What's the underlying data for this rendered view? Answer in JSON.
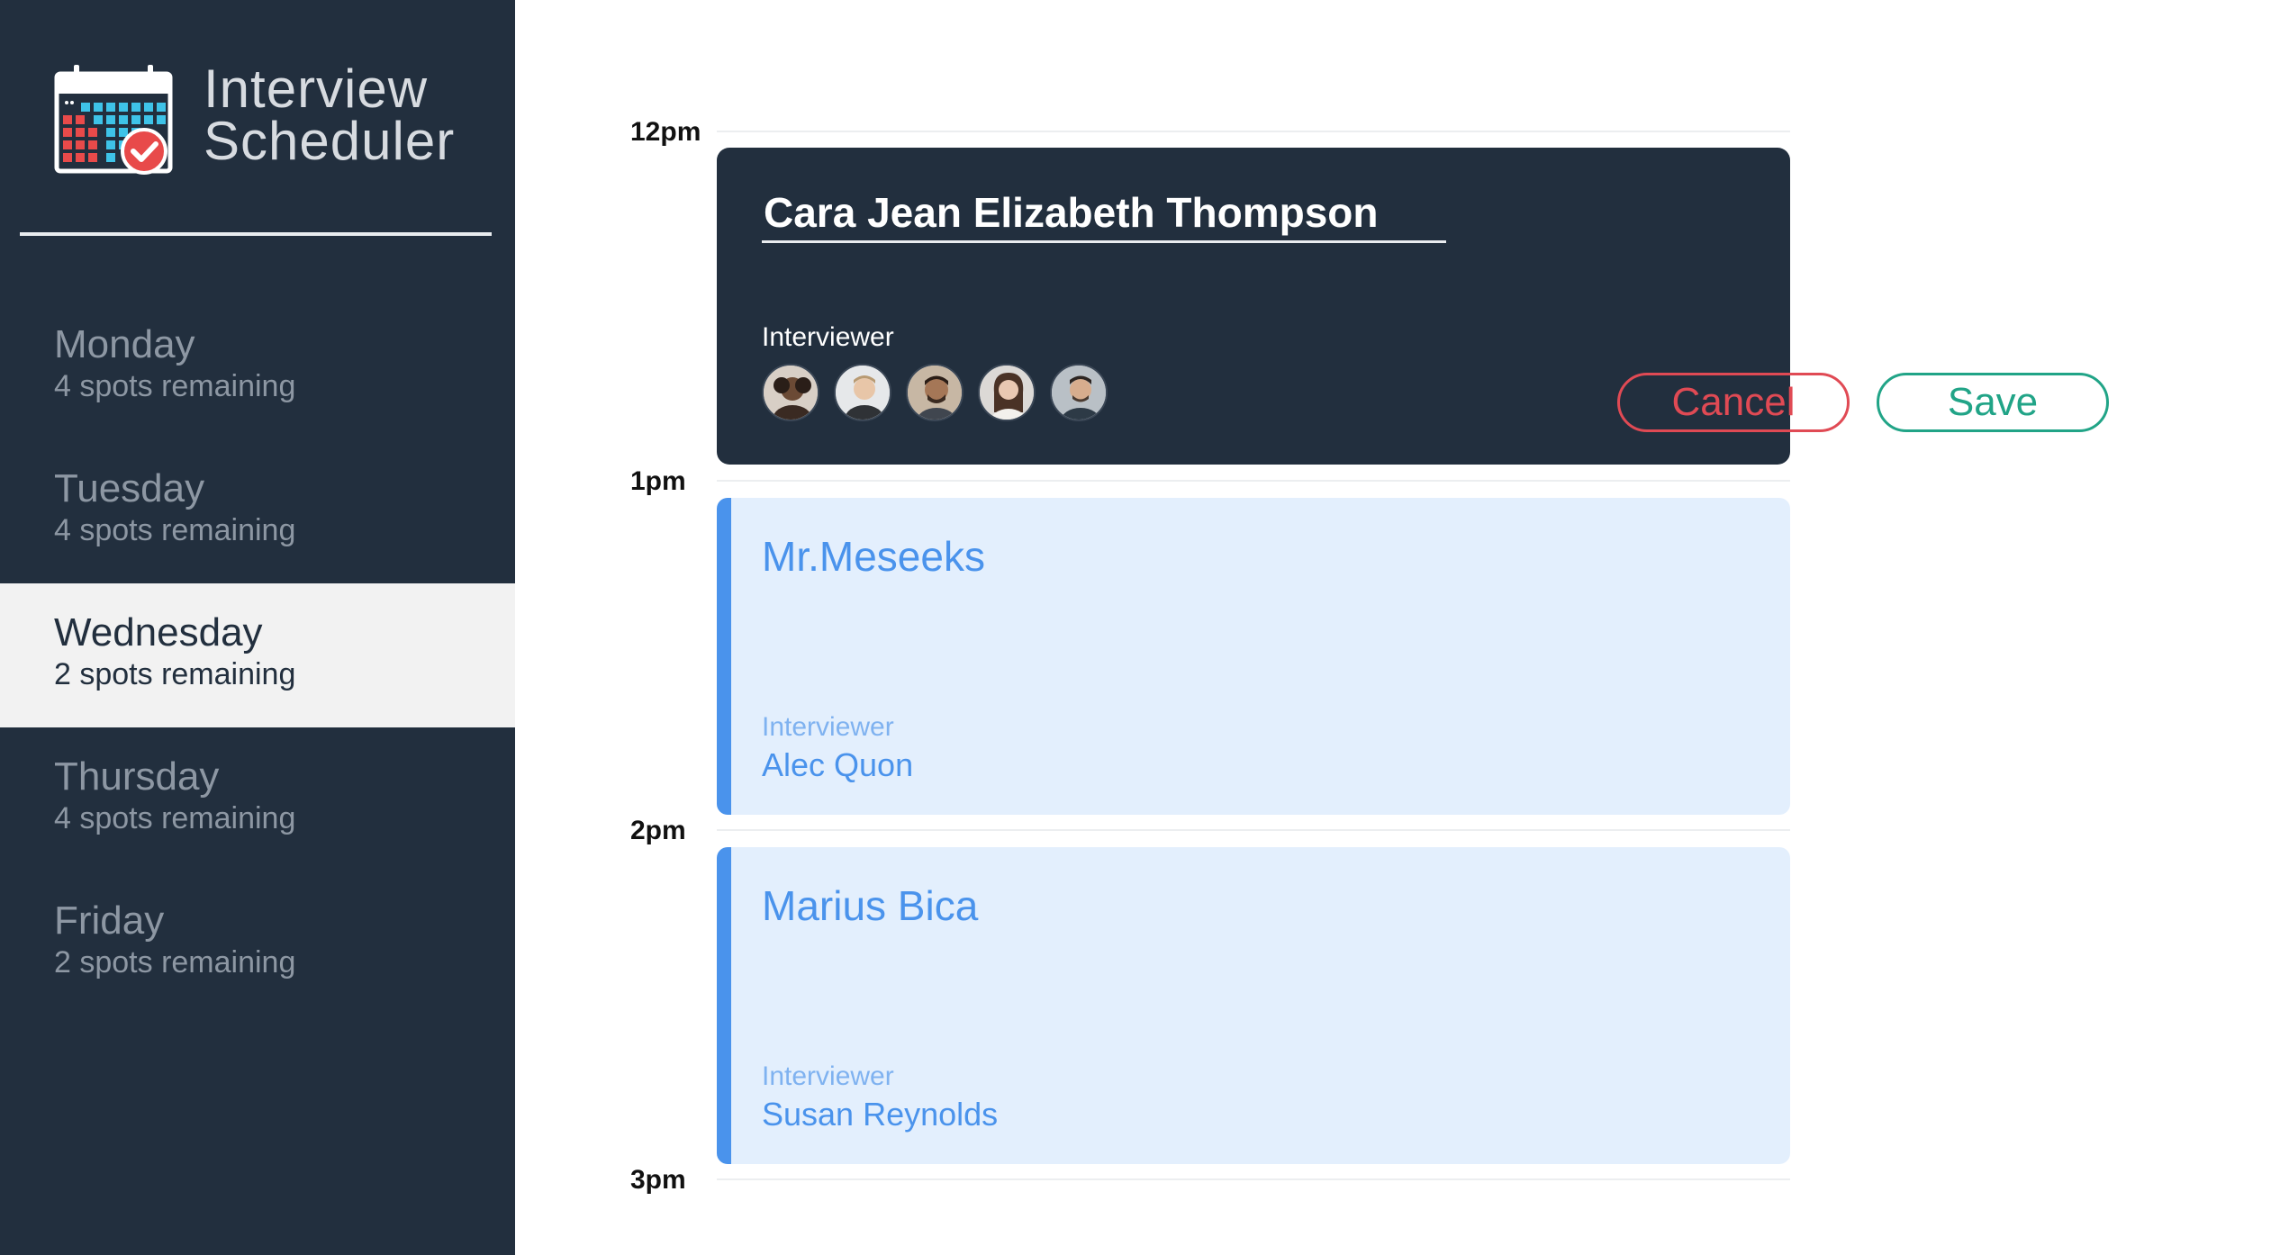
{
  "brand": {
    "line1": "Interview",
    "line2": "Scheduler"
  },
  "days": [
    {
      "name": "Monday",
      "spots": "4 spots remaining",
      "selected": false
    },
    {
      "name": "Tuesday",
      "spots": "4 spots remaining",
      "selected": false
    },
    {
      "name": "Wednesday",
      "spots": "2 spots remaining",
      "selected": true
    },
    {
      "name": "Thursday",
      "spots": "4 spots remaining",
      "selected": false
    },
    {
      "name": "Friday",
      "spots": "2 spots remaining",
      "selected": false
    }
  ],
  "times": [
    "12pm",
    "1pm",
    "2pm",
    "3pm"
  ],
  "form": {
    "student_name": "Cara Jean Elizabeth Thompson",
    "interviewer_label": "Interviewer",
    "cancel_label": "Cancel",
    "save_label": "Save"
  },
  "appointments": [
    {
      "student": "Mr.Meseeks",
      "interviewer_label": "Interviewer",
      "interviewer": "Alec Quon"
    },
    {
      "student": "Marius Bica",
      "interviewer_label": "Interviewer",
      "interviewer": "Susan Reynolds"
    }
  ],
  "colors": {
    "sidebar": "#222f3e",
    "selected_day_bg": "#f2f2f2",
    "cancel": "#e04a54",
    "save": "#21a487",
    "appointment_accent": "#4a93ec",
    "appointment_bg": "#e3effd"
  }
}
